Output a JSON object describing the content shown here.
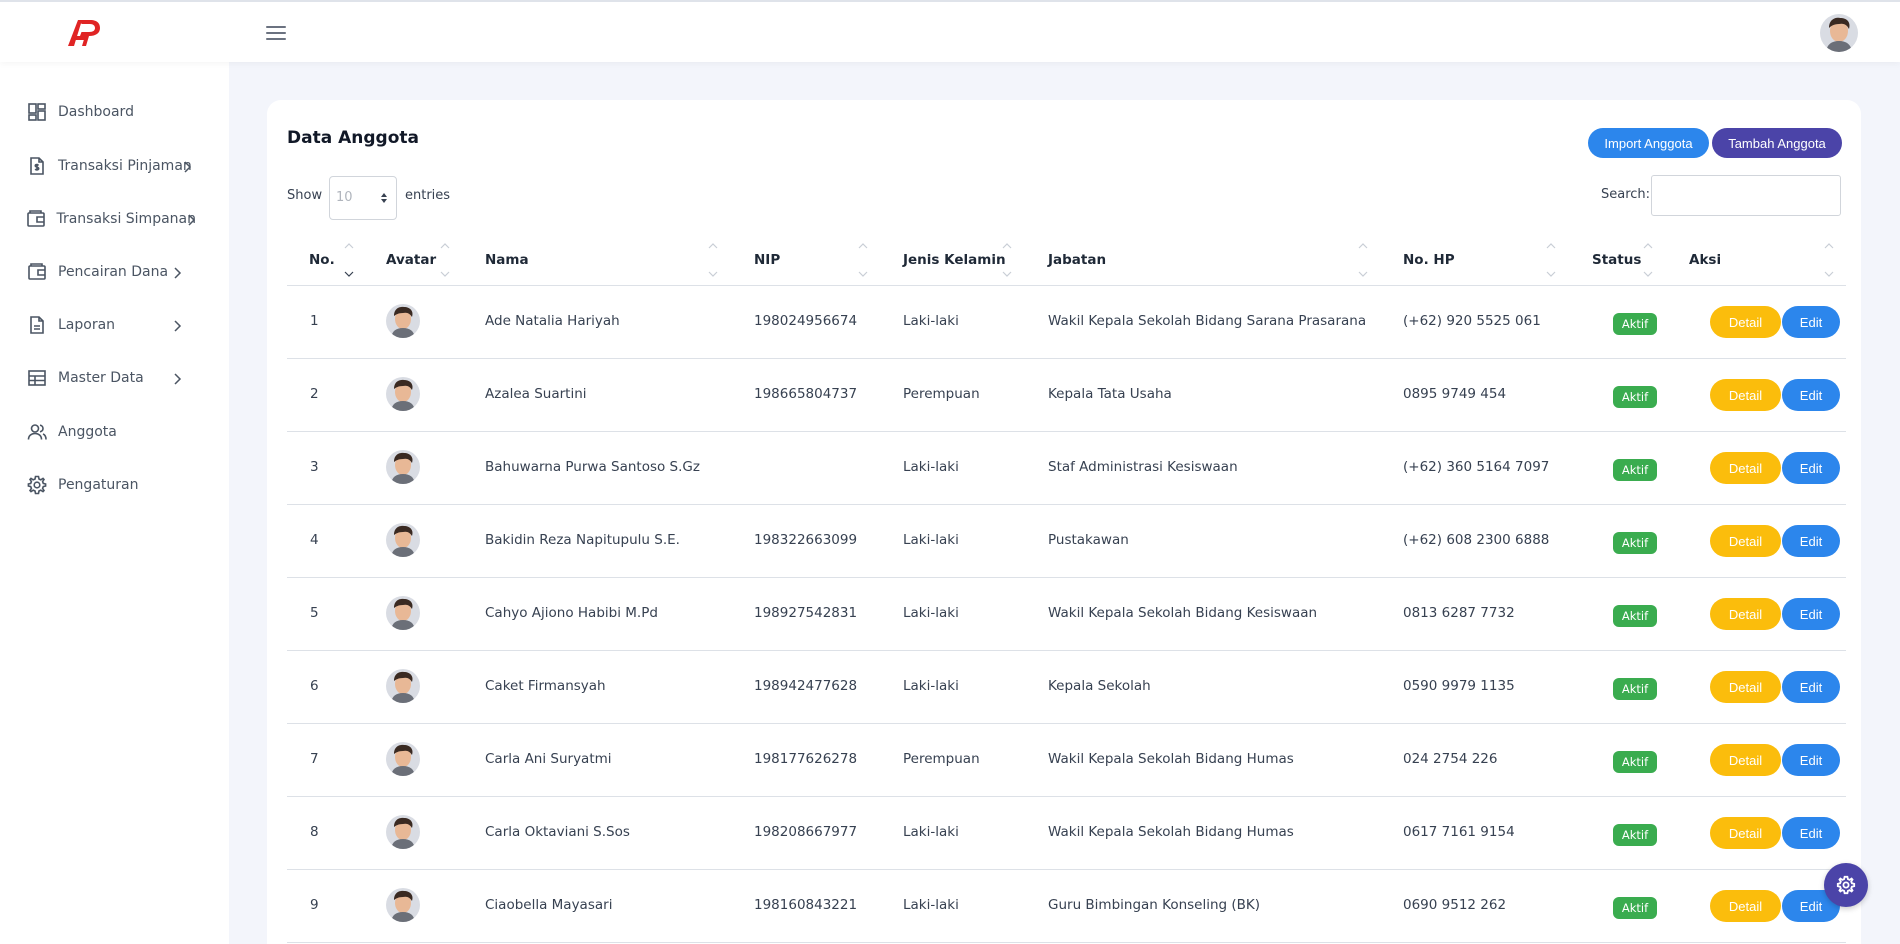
{
  "header": {
    "logo_text": "AP",
    "menu_icon": "hamburger-icon",
    "avatar_icon": "user-avatar"
  },
  "sidebar": {
    "items": [
      {
        "label": "Dashboard",
        "icon": "dashboard-icon",
        "has_chevron": false
      },
      {
        "label": "Transaksi Pinjaman",
        "icon": "document-dollar-icon",
        "has_chevron": true
      },
      {
        "label": "Transaksi Simpanan",
        "icon": "wallet-icon",
        "has_chevron": true
      },
      {
        "label": "Pencairan Dana",
        "icon": "wallet-icon",
        "has_chevron": true
      },
      {
        "label": "Laporan",
        "icon": "file-icon",
        "has_chevron": true
      },
      {
        "label": "Master Data",
        "icon": "table-icon",
        "has_chevron": true
      },
      {
        "label": "Anggota",
        "icon": "users-icon",
        "has_chevron": false
      },
      {
        "label": "Pengaturan",
        "icon": "gear-icon",
        "has_chevron": false
      }
    ]
  },
  "main": {
    "title": "Data Anggota",
    "import_label": "Import Anggota",
    "tambah_label": "Tambah Anggota",
    "show_label": "Show",
    "entries_value": "10",
    "entries_label": "entries",
    "search_label": "Search:",
    "search_value": "",
    "columns": [
      "No.",
      "Avatar",
      "Nama",
      "NIP",
      "Jenis Kelamin",
      "Jabatan",
      "No. HP",
      "Status",
      "Aksi"
    ],
    "detail_label": "Detail",
    "edit_label": "Edit",
    "rows": [
      {
        "no": "1",
        "nama": "Ade Natalia Hariyah",
        "nip": "198024956674",
        "jk": "Laki-laki",
        "jabatan": "Wakil Kepala Sekolah Bidang Sarana Prasarana",
        "hp": "(+62) 920 5525 061",
        "status": "Aktif"
      },
      {
        "no": "2",
        "nama": "Azalea Suartini",
        "nip": "198665804737",
        "jk": "Perempuan",
        "jabatan": "Kepala Tata Usaha",
        "hp": "0895 9749 454",
        "status": "Aktif"
      },
      {
        "no": "3",
        "nama": "Bahuwarna Purwa Santoso S.Gz",
        "nip": "",
        "jk": "Laki-laki",
        "jabatan": "Staf Administrasi Kesiswaan",
        "hp": "(+62) 360 5164 7097",
        "status": "Aktif"
      },
      {
        "no": "4",
        "nama": "Bakidin Reza Napitupulu S.E.",
        "nip": "198322663099",
        "jk": "Laki-laki",
        "jabatan": "Pustakawan",
        "hp": "(+62) 608 2300 6888",
        "status": "Aktif"
      },
      {
        "no": "5",
        "nama": "Cahyo Ajiono Habibi M.Pd",
        "nip": "198927542831",
        "jk": "Laki-laki",
        "jabatan": "Wakil Kepala Sekolah Bidang Kesiswaan",
        "hp": "0813 6287 7732",
        "status": "Aktif"
      },
      {
        "no": "6",
        "nama": "Caket Firmansyah",
        "nip": "198942477628",
        "jk": "Laki-laki",
        "jabatan": "Kepala Sekolah",
        "hp": "0590 9979 1135",
        "status": "Aktif"
      },
      {
        "no": "7",
        "nama": "Carla Ani Suryatmi",
        "nip": "198177626278",
        "jk": "Perempuan",
        "jabatan": "Wakil Kepala Sekolah Bidang Humas",
        "hp": "024 2754 226",
        "status": "Aktif"
      },
      {
        "no": "8",
        "nama": "Carla Oktaviani S.Sos",
        "nip": "198208667977",
        "jk": "Laki-laki",
        "jabatan": "Wakil Kepala Sekolah Bidang Humas",
        "hp": "0617 7161 9154",
        "status": "Aktif"
      },
      {
        "no": "9",
        "nama": "Ciaobella Mayasari",
        "nip": "198160843221",
        "jk": "Laki-laki",
        "jabatan": "Guru Bimbingan Konseling (BK)",
        "hp": "0690 9512 262",
        "status": "Aktif"
      }
    ]
  },
  "colors": {
    "primary": "#2c86ec",
    "purple": "#4b44a8",
    "warning": "#fbbd0c",
    "success": "#3aac4f",
    "logo_red": "#e02424"
  },
  "fab_icon": "gear-icon"
}
